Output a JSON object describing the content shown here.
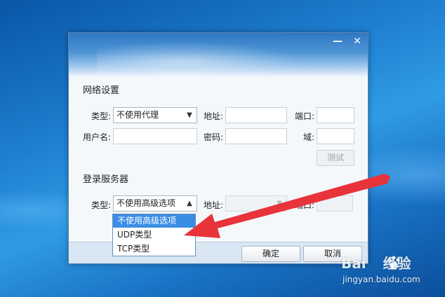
{
  "window": {
    "minimize_glyph": "—",
    "close_glyph": "✕"
  },
  "network": {
    "section_title": "网络设置",
    "type_label": "类型:",
    "type_value": "不使用代理",
    "address_label": "地址:",
    "port_label": "端口:",
    "username_label": "用户名:",
    "password_label": "密码:",
    "domain_label": "域:",
    "test_button": "测试"
  },
  "login_server": {
    "section_title": "登录服务器",
    "type_label": "类型:",
    "type_value": "不使用高级选项",
    "address_label": "地址:",
    "port_label": "端口:",
    "options": [
      "不使用高级选项",
      "UDP类型",
      "TCP类型"
    ],
    "selected_index": 0
  },
  "footer": {
    "ok_button": "确定",
    "cancel_button": "取消"
  },
  "watermark": {
    "logo_text": "Bai",
    "logo_text_2": "经验",
    "url": "jingyan.baidu.com"
  },
  "colors": {
    "annotation_arrow": "#e8333a",
    "dropdown_selected": "#3a8ee6"
  },
  "icons": {
    "dropdown_arrow": "▼",
    "dropdown_arrow_open": "▲"
  }
}
